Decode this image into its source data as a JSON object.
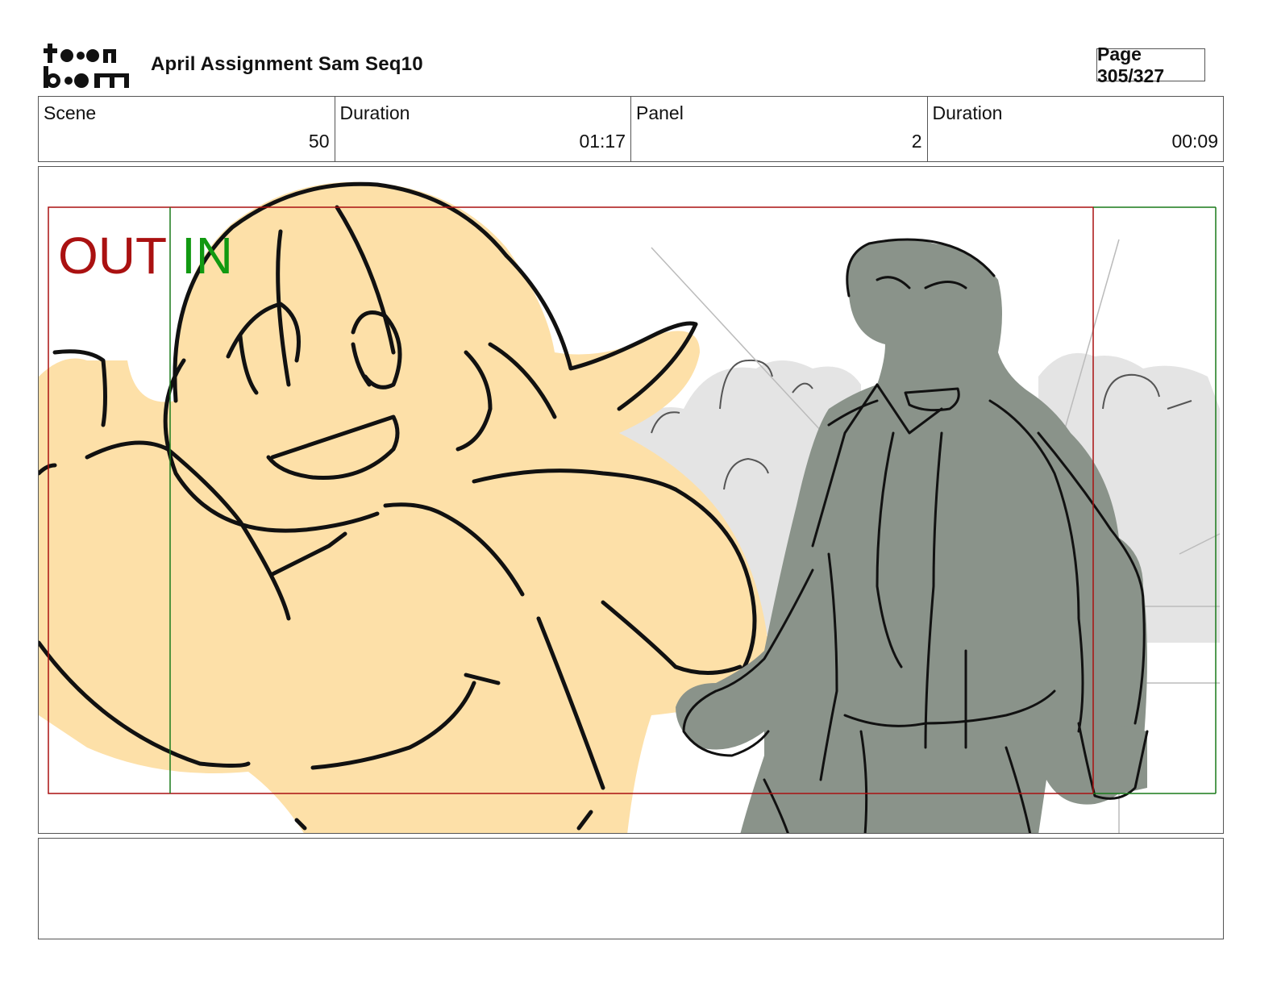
{
  "header": {
    "logo_text_top": "toon",
    "logo_text_bottom": "boom",
    "title": "April Assignment Sam Seq10",
    "page_label": "Page 305/327"
  },
  "info": {
    "scene_label": "Scene",
    "scene_value": "50",
    "scene_duration_label": "Duration",
    "scene_duration_value": "01:17",
    "panel_label": "Panel",
    "panel_value": "2",
    "panel_duration_label": "Duration",
    "panel_duration_value": "00:09"
  },
  "panel": {
    "field_out_label": "OUT",
    "field_in_label": "IN",
    "out_color": "#aa1111",
    "in_color": "#119911",
    "skin_color": "#fde0a8",
    "character_color": "#8a938a",
    "background_color": "#e4e4e4"
  },
  "notes": {
    "text": ""
  }
}
